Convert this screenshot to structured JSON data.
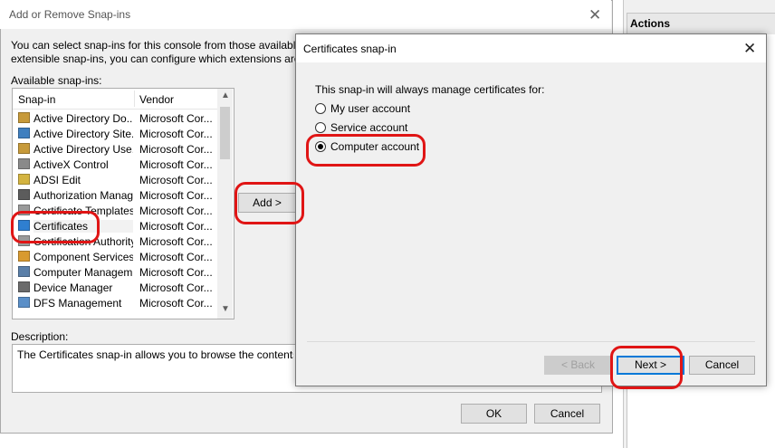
{
  "actions_panel": {
    "title": "Actions"
  },
  "main_dialog": {
    "title": "Add or Remove Snap-ins",
    "intro_line1": "You can select snap-ins for this console from those available on y",
    "intro_line2": "extensible snap-ins, you can configure which extensions are enal",
    "available_label": "Available snap-ins:",
    "columns": {
      "snapin": "Snap-in",
      "vendor": "Vendor"
    },
    "snapins": [
      {
        "name": "Active Directory Do...",
        "vendor": "Microsoft Cor...",
        "icon": "directory-icon"
      },
      {
        "name": "Active Directory Site...",
        "vendor": "Microsoft Cor...",
        "icon": "directory-sites-icon"
      },
      {
        "name": "Active Directory Use...",
        "vendor": "Microsoft Cor...",
        "icon": "directory-users-icon"
      },
      {
        "name": "ActiveX Control",
        "vendor": "Microsoft Cor...",
        "icon": "activex-icon"
      },
      {
        "name": "ADSI Edit",
        "vendor": "Microsoft Cor...",
        "icon": "adsi-edit-icon"
      },
      {
        "name": "Authorization Manager",
        "vendor": "Microsoft Cor...",
        "icon": "authorization-icon"
      },
      {
        "name": "Certificate Templates",
        "vendor": "Microsoft Cor...",
        "icon": "certificate-templates-icon"
      },
      {
        "name": "Certificates",
        "vendor": "Microsoft Cor...",
        "icon": "certificates-icon"
      },
      {
        "name": "Certification Authority",
        "vendor": "Microsoft Cor...",
        "icon": "certification-authority-icon"
      },
      {
        "name": "Component Services",
        "vendor": "Microsoft Cor...",
        "icon": "component-services-icon"
      },
      {
        "name": "Computer Managem",
        "vendor": "Microsoft Cor...",
        "icon": "computer-management-icon"
      },
      {
        "name": "Device Manager",
        "vendor": "Microsoft Cor...",
        "icon": "device-manager-icon"
      },
      {
        "name": "DFS Management",
        "vendor": "Microsoft Cor...",
        "icon": "dfs-management-icon"
      }
    ],
    "add_button": "Add >",
    "description_label": "Description:",
    "description_text": "The Certificates snap-in allows you to browse the contents of th",
    "ok_button": "OK",
    "cancel_button": "Cancel"
  },
  "cert_dialog": {
    "title": "Certificates snap-in",
    "message": "This snap-in will always manage certificates for:",
    "options": [
      {
        "label": "My user account",
        "selected": false
      },
      {
        "label": "Service account",
        "selected": false
      },
      {
        "label": "Computer account",
        "selected": true
      }
    ],
    "back_button": "< Back",
    "next_button": "Next >",
    "cancel_button": "Cancel"
  },
  "colors": {
    "annotation": "#e01515",
    "focus": "#0078d7"
  }
}
